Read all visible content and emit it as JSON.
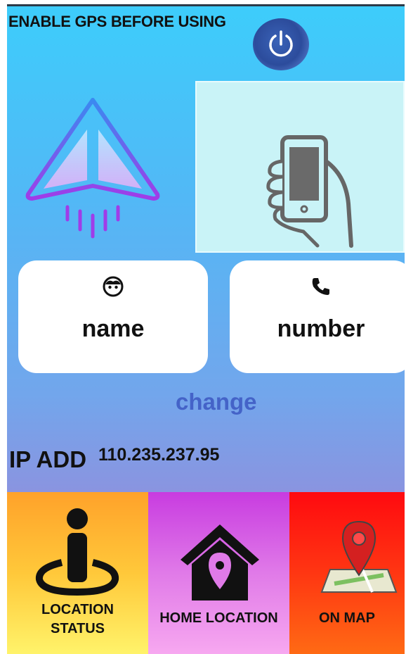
{
  "header": {
    "gps_warning": "ENABLE GPS BEFORE USING"
  },
  "icons": {
    "power": "power-icon",
    "plane": "paper-plane-icon",
    "phone": "hand-phone-icon",
    "face": "face-icon",
    "phone_call": "phone-icon",
    "person_location": "person-location-icon",
    "home_location": "home-location-icon",
    "map": "map-pin-icon"
  },
  "cards": {
    "name_label": "name",
    "number_label": "number"
  },
  "change_label": "change",
  "ip": {
    "label": "IP ADD",
    "value": "110.235.237.95"
  },
  "bottom": {
    "location_status_line1": "LOCATION",
    "location_status_line2": "STATUS",
    "home_location": "HOME LOCATION",
    "on_map": "ON MAP"
  },
  "colors": {
    "bg_top": "#3dcdfb",
    "bg_bottom": "#8a94e0",
    "change": "#4463c8",
    "phone_panel": "#c9f3f7",
    "tile_location": "#ffc83a",
    "tile_home": "#e07ae8",
    "tile_map": "#ff3612"
  }
}
